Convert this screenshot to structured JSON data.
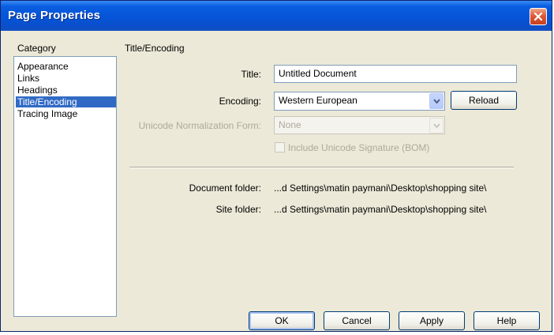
{
  "window": {
    "title": "Page Properties"
  },
  "category": {
    "header": "Category",
    "items": [
      {
        "label": "Appearance",
        "selected": false
      },
      {
        "label": "Links",
        "selected": false
      },
      {
        "label": "Headings",
        "selected": false
      },
      {
        "label": "Title/Encoding",
        "selected": true
      },
      {
        "label": "Tracing Image",
        "selected": false
      }
    ]
  },
  "section": {
    "title": "Title/Encoding"
  },
  "form": {
    "title_label": "Title:",
    "title_value": "Untitled Document",
    "encoding_label": "Encoding:",
    "encoding_value": "Western European",
    "reload_label": "Reload",
    "normalization_label": "Unicode Normalization Form:",
    "normalization_value": "None",
    "bom_label": "Include Unicode Signature (BOM)",
    "document_folder_label": "Document folder:",
    "document_folder_value": "...d Settings\\matin paymani\\Desktop\\shopping site\\",
    "site_folder_label": "Site folder:",
    "site_folder_value": "...d Settings\\matin paymani\\Desktop\\shopping site\\"
  },
  "buttons": {
    "ok": "OK",
    "cancel": "Cancel",
    "apply": "Apply",
    "help": "Help"
  },
  "icons": {
    "close": "close-icon",
    "dropdown": "chevron-down-icon"
  },
  "colors": {
    "titlebar": "#0654d8",
    "selection": "#316ac5",
    "dialog_bg": "#ece9d8"
  }
}
